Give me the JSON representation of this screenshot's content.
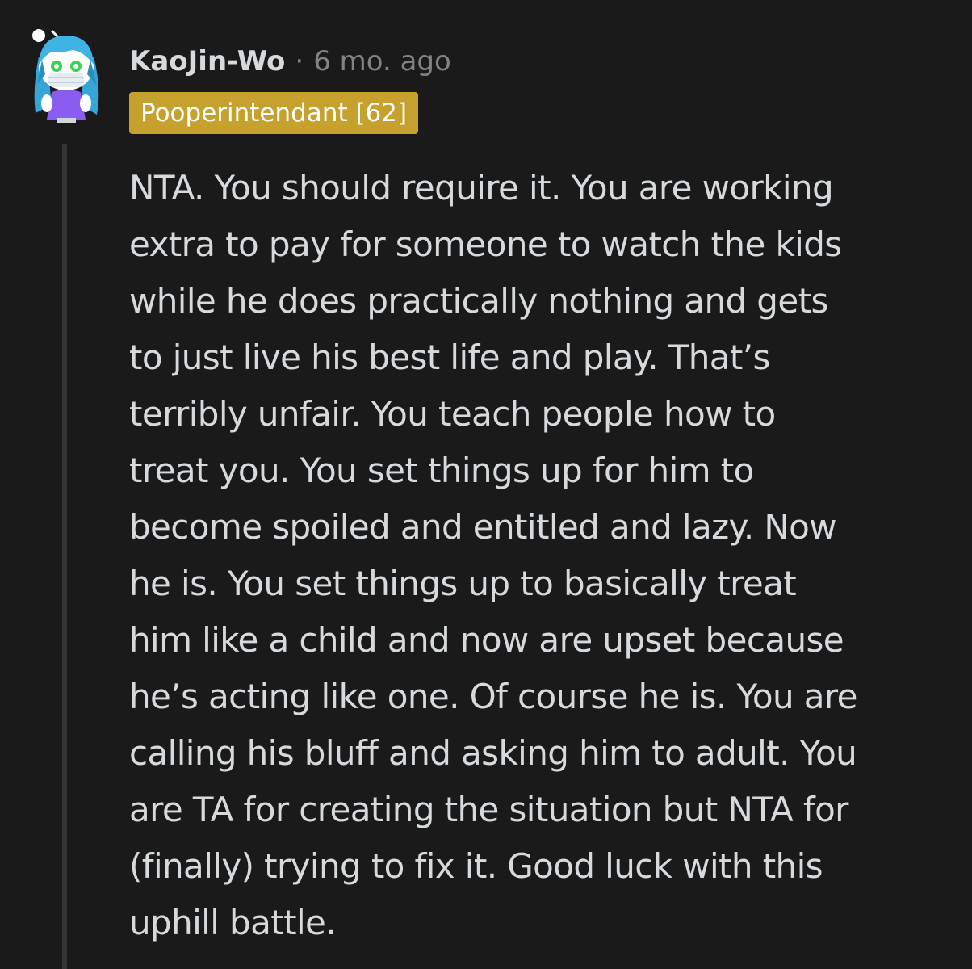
{
  "comment": {
    "author": "KaoJin-Wo",
    "separator": "·",
    "timestamp": "6 mo. ago",
    "flair": "Pooperintendant [62]",
    "body_lines": [
      "NTA. You should require it. You are working",
      "extra to pay for someone to watch the kids",
      "while he does practically nothing and gets",
      "to just live his best life and play. That’s",
      "terribly unfair. You teach people how to",
      "treat you. You set things up for him to",
      "become spoiled and entitled and lazy. Now",
      "he is. You set things up to basically treat",
      "him like a child and now are upset because",
      "he’s acting like one. Of course he is. You are",
      "calling his bluff and asking him to adult. You",
      "are TA for creating the situation but NTA for",
      "(finally) trying to fix it. Good luck with this",
      "uphill battle."
    ]
  },
  "colors": {
    "background": "#1a1a1b",
    "text": "#d7dadc",
    "muted": "#818384",
    "flair_bg": "#c6a12e",
    "thread_line": "#343536"
  },
  "icons": {
    "avatar": "snoo-avatar-blue-hair-mask-icon"
  }
}
